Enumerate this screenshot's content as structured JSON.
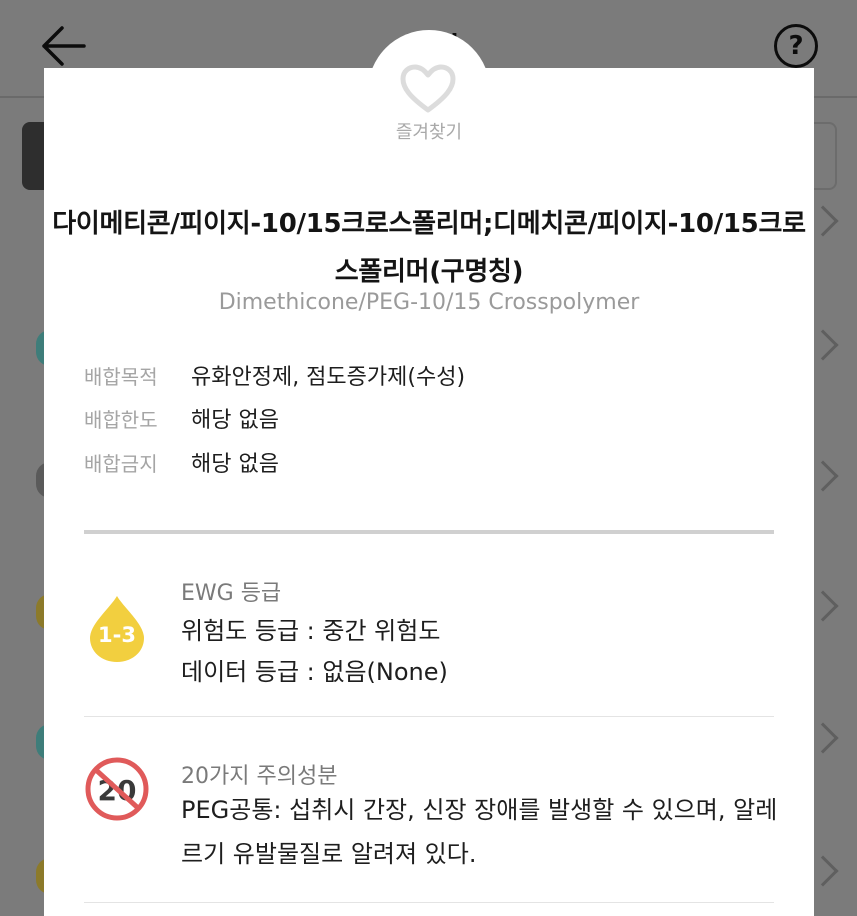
{
  "background_app": {
    "title": "성분",
    "help_label": "?"
  },
  "modal": {
    "favorite_label": "즐겨찾기",
    "ingredient_name_ko": "다이메티콘/피이지-10/15크로스폴리머;디메치콘/피이지-10/15크로스폴리머(구명칭)",
    "ingredient_name_en": "Dimethicone/PEG-10/15 Crosspolymer",
    "info": [
      {
        "key": "배합목적",
        "value": "유화안정제, 점도증가제(수성)"
      },
      {
        "key": "배합한도",
        "value": "해당 없음"
      },
      {
        "key": "배합금지",
        "value": "해당 없음"
      }
    ],
    "ewg": {
      "title": "EWG 등급",
      "badge": "1-3",
      "badge_color": "#f2cf3f",
      "hazard_line": "위험도 등급 : 중간 위험도",
      "data_line": "데이터 등급 : 없음(None)"
    },
    "caution20": {
      "title": "20가지 주의성분",
      "badge": "20",
      "badge_color": "#e05a5a",
      "description": "PEG공통: 섭취시 간장, 신장 장애를 발생할 수 있으며, 알레르기 유발물질로 알려져 있다."
    }
  },
  "colors": {
    "overlay": "#7b7b7b",
    "heart": "#dcdcdc"
  }
}
